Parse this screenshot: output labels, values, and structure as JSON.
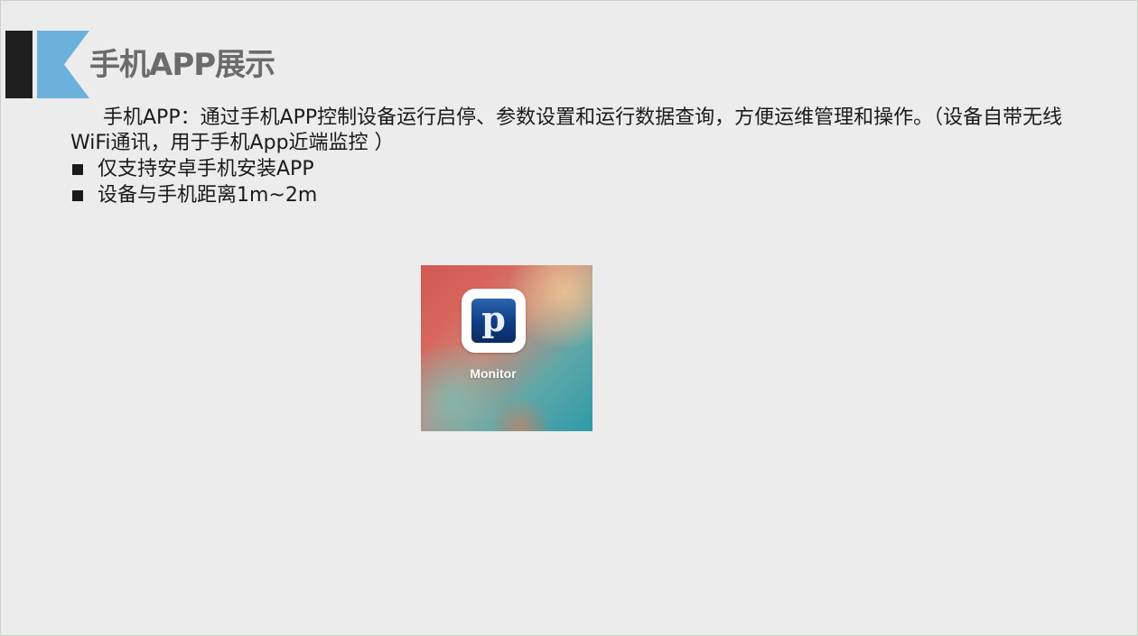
{
  "header": {
    "title": "手机APP展示"
  },
  "intro": {
    "text": "手机APP：通过手机APP控制设备运行启停、参数设置和运行数据查询，方便运维管理和操作。（设备自带无线WiFi通讯，用于手机App近端监控 ）"
  },
  "bullets": [
    "仅支持安卓手机安装APP",
    "设备与手机距离1m~2m"
  ],
  "app": {
    "icon_glyph": "p",
    "icon_name": "monitor-app-icon",
    "label": "Monitor"
  },
  "colors": {
    "title_text": "#6b6b6b",
    "accent_blue": "#6cb0dc",
    "dark_bar": "#1f1f1f",
    "body_text": "#1a1a1a",
    "background": "#ececec"
  }
}
